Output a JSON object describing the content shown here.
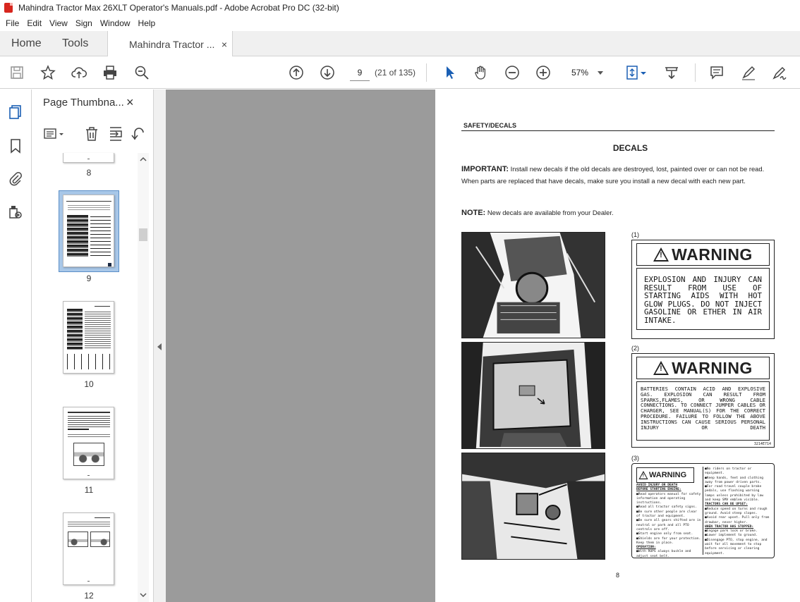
{
  "window": {
    "title": "Mahindra Tractor Max 26XLT Operator's Manuals.pdf - Adobe Acrobat Pro DC (32-bit)"
  },
  "menu": [
    "File",
    "Edit",
    "View",
    "Sign",
    "Window",
    "Help"
  ],
  "tabs": {
    "home": "Home",
    "tools": "Tools",
    "document": "Mahindra Tractor ...",
    "close": "×"
  },
  "toolbar": {
    "page_current": "9",
    "page_count": "(21 of 135)",
    "zoom": "57%"
  },
  "thumbnails": {
    "title": "Page Thumbna...",
    "close": "×",
    "pages": [
      "8",
      "9",
      "10",
      "11",
      "12"
    ],
    "selected": "9"
  },
  "document": {
    "header": "SAFETY/DECALS",
    "title": "DECALS",
    "important_label": "IMPORTANT:",
    "important_text": " Install new decals if the old decals are destroyed, lost, painted over or can not be read. When parts are replaced that have decals, make sure you install a new decal with each new part.",
    "note_label": "NOTE:",
    "note_text": " New decals are available from your Dealer.",
    "page_number": "8",
    "decals": [
      {
        "label": "(1)",
        "banner": "WARNING",
        "text": "EXPLOSION AND INJURY CAN RESULT FROM USE OF STARTING AIDS WITH HOT GLOW PLUGS. DO NOT INJECT GASOLINE OR ETHER IN AIR INTAKE."
      },
      {
        "label": "(2)",
        "banner": "WARNING",
        "text": "BATTERIES CONTAIN ACID AND EXPLOSIVE GAS. EXPLOSION CAN RESULT FROM SPARKS,FLAMES, OR WRONG CABLE CONNECTIONS. TO CONNECT JUMPER CABLES OR CHARGER, SEE MANUAL(S) FOR THE CORRECT PROCEDURE. FAILURE TO FOLLOW THE ABOVE INSTRUCTIONS CAN CAUSE SERIOUS PERSONAL INJURY OR DEATH",
        "code": "3214E714"
      },
      {
        "label": "(3)",
        "banner": "WARNING",
        "subtitle": "AVOID INJURY OR DEATH",
        "left": [
          "BEFORE STARTING ENGINE:",
          "Read operators manual for safety information and operating instructions.",
          "Read all tractor safety signs.",
          "Be sure other people are clear of tractor and equipment.",
          "Be sure all gears shifted are in neutral or park and all PTO controls are off.",
          "Start engine only from seat.",
          "Shields are for your protection. Keep them in place.",
          "OPERATION:",
          "With ROPS always buckle and adjust seat belt."
        ],
        "right": [
          "No riders on tractor or equipment.",
          "Keep hands, feet and clothing away from power driven parts.",
          "For road travel couple brake pedals, use flashing warning lamps unless prohibited by law and keep SMV emblem visible.",
          "TRACTORS CAN BE UPSET:",
          "Reduce speed on turns and rough ground. Avoid steep slopes.",
          "Avoid rear upset. Pull only from drawbar, never higher.",
          "WHEN TRACTOR HAS STOPPED:",
          "Engage park lock or brake.",
          "Lower implement to ground.",
          "Disengage PTO, stop engine, and wait for all movement to stop before servicing or clearing equipment."
        ]
      }
    ]
  }
}
